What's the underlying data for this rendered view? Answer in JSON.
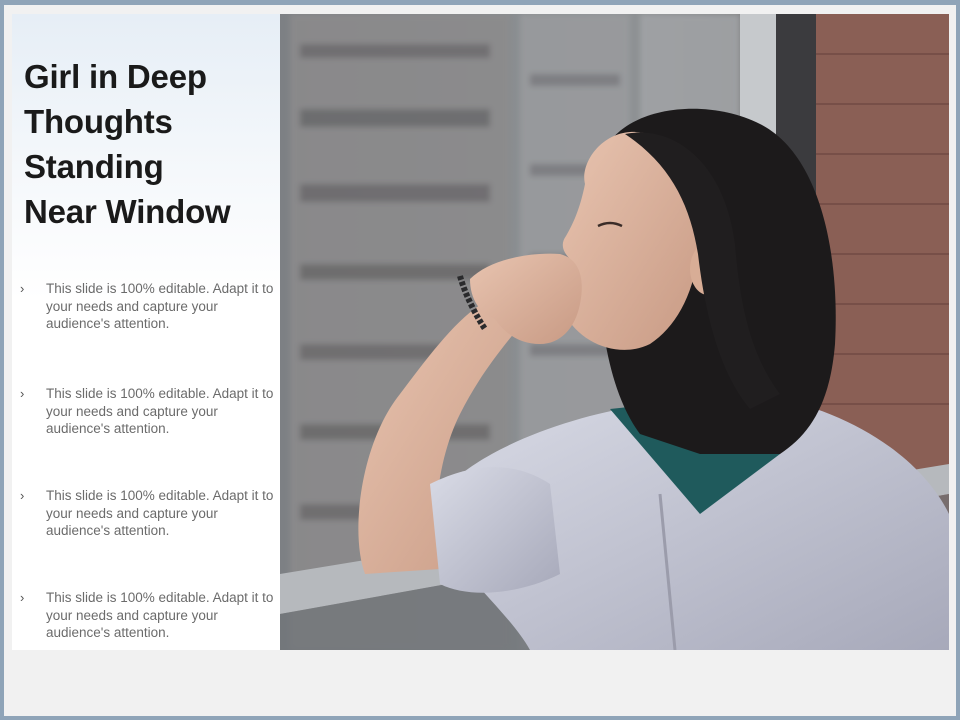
{
  "slide": {
    "title_lines": [
      "Girl in Deep",
      "Thoughts",
      "Standing",
      "Near Window"
    ],
    "bullet_icon": "chevron-right-icon",
    "bullets": [
      {
        "marker": "›",
        "text": "This slide is 100% editable. Adapt it to your needs and capture your audience's attention."
      },
      {
        "marker": "›",
        "text": "This slide is 100% editable. Adapt it to your needs and capture your audience's attention."
      },
      {
        "marker": "›",
        "text": "This slide is 100% editable. Adapt it to your needs and capture your audience's attention."
      },
      {
        "marker": "›",
        "text": "This slide is 100% editable. Adapt it to your needs and capture your audience's attention."
      }
    ]
  },
  "colors": {
    "frame": "#8fa4b8",
    "slide_background": "#f1f1f1",
    "title": "#1a1a1a",
    "bullet_text": "#6b6b6b"
  }
}
